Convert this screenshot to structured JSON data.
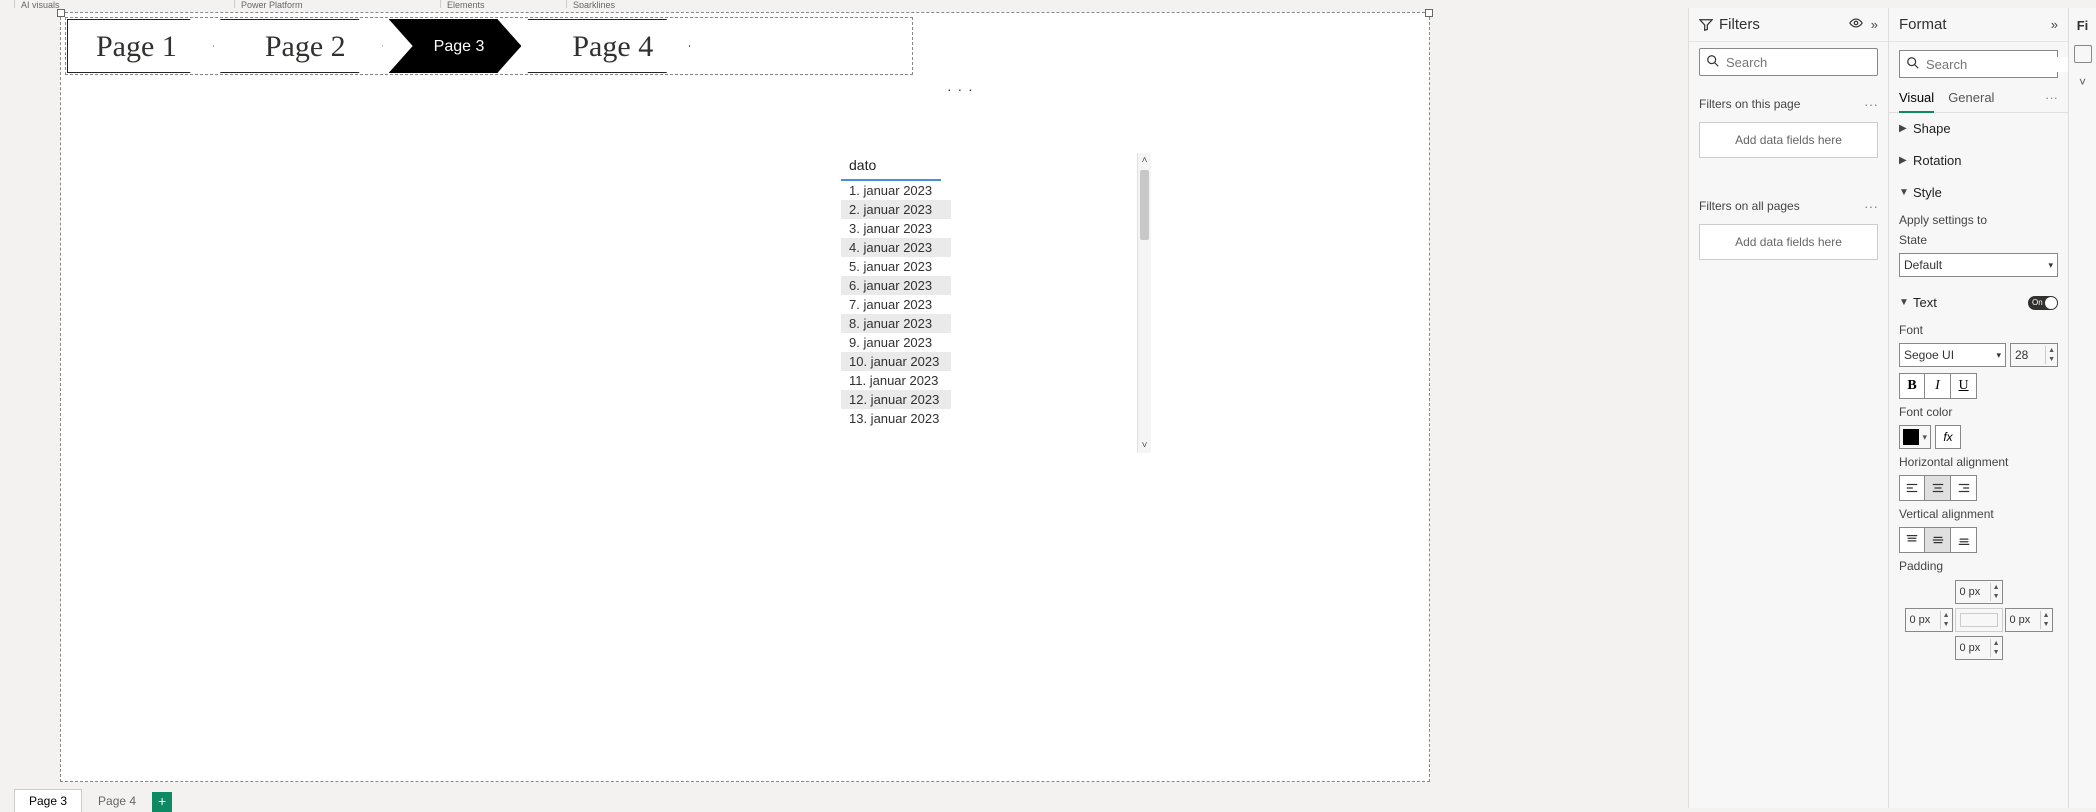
{
  "ribbon_groups": [
    "AI visuals",
    "Power Platform",
    "Elements",
    "Sparklines"
  ],
  "nav": {
    "pages": [
      "Page 1",
      "Page 2",
      "Page 3",
      "Page 4"
    ],
    "active_index": 2
  },
  "table": {
    "header": "dato",
    "rows": [
      "1. januar 2023",
      "2. januar 2023",
      "3. januar 2023",
      "4. januar 2023",
      "5. januar 2023",
      "6. januar 2023",
      "7. januar 2023",
      "8. januar 2023",
      "9. januar 2023",
      "10. januar 2023",
      "11. januar 2023",
      "12. januar 2023",
      "13. januar 2023"
    ]
  },
  "page_tabs": {
    "tabs": [
      "Page 3",
      "Page 4"
    ],
    "active_index": 0
  },
  "filters_pane": {
    "title": "Filters",
    "search_placeholder": "Search",
    "section_page": "Filters on this page",
    "section_all": "Filters on all pages",
    "drop_hint": "Add data fields here"
  },
  "format_pane": {
    "title": "Format",
    "search_placeholder": "Search",
    "tabs": {
      "visual": "Visual",
      "general": "General"
    },
    "shape": "Shape",
    "rotation": "Rotation",
    "style": "Style",
    "apply_settings": "Apply settings to",
    "state_label": "State",
    "state_value": "Default",
    "text": {
      "label": "Text",
      "toggle": "On"
    },
    "font_label": "Font",
    "font_value": "Segoe UI",
    "font_size": "28",
    "bold": "B",
    "italic": "I",
    "underline": "U",
    "font_color_label": "Font color",
    "fx": "fx",
    "h_align_label": "Horizontal alignment",
    "v_align_label": "Vertical alignment",
    "padding_label": "Padding",
    "pad_top": "0  px",
    "pad_left": "0  px",
    "pad_right": "0  px",
    "pad_bottom": "0  px"
  },
  "stub": {
    "label": "Fi"
  }
}
